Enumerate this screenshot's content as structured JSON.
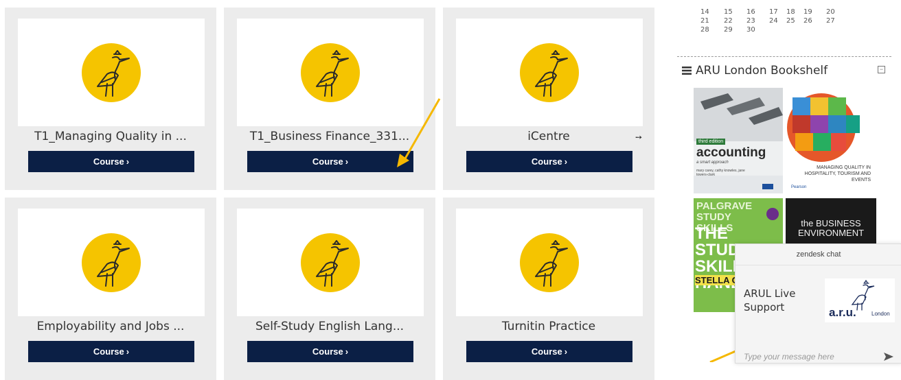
{
  "courses": [
    {
      "title": "T1_Managing Quality in ...",
      "button": "Course"
    },
    {
      "title": "T1_Business Finance_331...",
      "button": "Course"
    },
    {
      "title": "iCentre",
      "button": "Course"
    },
    {
      "title": "Employability and Jobs ...",
      "button": "Course"
    },
    {
      "title": "Self-Study English Lang...",
      "button": "Course"
    },
    {
      "title": "Turnitin Practice",
      "button": "Course"
    }
  ],
  "calendar": {
    "weeks": [
      [
        "14",
        "15",
        "16",
        "17",
        "18",
        "19",
        "20"
      ],
      [
        "21",
        "22",
        "23",
        "24",
        "25",
        "26",
        "27"
      ],
      [
        "28",
        "29",
        "30"
      ]
    ]
  },
  "bookshelf": {
    "title": "ARU London Bookshelf",
    "books": [
      {
        "title": "accounting",
        "subtitle": "a smart approach",
        "authors": "mary carey, cathy knowles, jane towers-clark",
        "edition": "third edition"
      },
      {
        "title": "MANAGING QUALITY IN HOSPITALITY, TOURISM AND EVENTS",
        "publisher": "Pearson"
      },
      {
        "title": "THE STUDY SKILLS HANDBOOK",
        "series": "PALGRAVE STUDY SKILLS",
        "author": "STELLA COTTRELL"
      },
      {
        "title": "the BUSINESS ENVIRONMENT"
      }
    ]
  },
  "chat": {
    "header": "zendesk chat",
    "name": "ARUL Live Support",
    "logo_text": "a.r.u.",
    "logo_sub": "London",
    "placeholder": "Type your message here"
  },
  "colors": {
    "accent": "#0b1f45",
    "logo_yellow": "#f5c400",
    "arrow": "#f5b800"
  }
}
